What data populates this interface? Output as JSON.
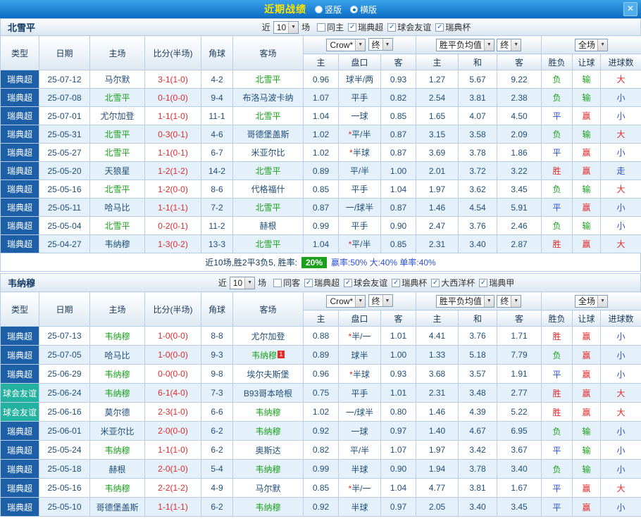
{
  "titlebar": {
    "title": "近期战绩",
    "options": [
      {
        "label": "竖版",
        "selected": false
      },
      {
        "label": "横版",
        "selected": true
      }
    ],
    "close_label": "✕"
  },
  "colors": {
    "win": "#e02b2b",
    "draw": "#2b50d9",
    "lose": "#1ca11c",
    "focus_team": "#1ca11c",
    "score": "#e02b2b",
    "league_super_bg": "#1d60a8",
    "league_friendly_bg": "#23b1a0",
    "title_text": "#ffe400",
    "rate_badge_bg": "#1ca11c"
  },
  "table_header": {
    "static_cols": [
      "类型",
      "日期",
      "主场",
      "比分(半场)",
      "角球",
      "客场"
    ],
    "groups": [
      {
        "selects": [
          "Crow*",
          "终"
        ],
        "subs": [
          "主",
          "盘口",
          "客"
        ]
      },
      {
        "selects": [
          "胜平负均值",
          "终"
        ],
        "subs": [
          "主",
          "和",
          "客"
        ]
      },
      {
        "selects": [
          "全场"
        ],
        "subs": [
          "胜负",
          "让球",
          "进球数"
        ]
      }
    ]
  },
  "sections": [
    {
      "team": "北雪平",
      "filter": {
        "near": "近",
        "count": "10",
        "games": "场",
        "checkboxes": [
          {
            "label": "同主",
            "checked": false
          },
          {
            "label": "瑞典超",
            "checked": true
          },
          {
            "label": "球会友谊",
            "checked": true
          },
          {
            "label": "瑞典杯",
            "checked": true
          }
        ]
      },
      "rows": [
        {
          "league": "瑞典超",
          "date": "25-07-12",
          "home": "马尔默",
          "score": "3-1(1-0)",
          "corners": "4-2",
          "away": "北雪平",
          "focus": "away",
          "crow": [
            "0.96",
            "球半/两",
            "0.93"
          ],
          "odds": [
            "1.27",
            "5.67",
            "9.22"
          ],
          "results": [
            "负",
            "输",
            "大"
          ]
        },
        {
          "league": "瑞典超",
          "date": "25-07-08",
          "home": "北雪平",
          "score": "0-1(0-0)",
          "corners": "9-4",
          "away": "布洛马波卡纳",
          "focus": "home",
          "crow": [
            "1.07",
            "平手",
            "0.82"
          ],
          "odds": [
            "2.54",
            "3.81",
            "2.38"
          ],
          "results": [
            "负",
            "输",
            "小"
          ]
        },
        {
          "league": "瑞典超",
          "date": "25-07-01",
          "home": "尤尔加登",
          "score": "1-1(1-0)",
          "corners": "11-1",
          "away": "北雪平",
          "focus": "away",
          "crow": [
            "1.04",
            "一球",
            "0.85"
          ],
          "odds": [
            "1.65",
            "4.07",
            "4.50"
          ],
          "results": [
            "平",
            "赢",
            "小"
          ]
        },
        {
          "league": "瑞典超",
          "date": "25-05-31",
          "home": "北雪平",
          "score": "0-3(0-1)",
          "corners": "4-6",
          "away": "哥德堡盖斯",
          "focus": "home",
          "crow": [
            "1.02",
            "*平/半",
            "0.87"
          ],
          "odds": [
            "3.15",
            "3.58",
            "2.09"
          ],
          "results": [
            "负",
            "输",
            "大"
          ]
        },
        {
          "league": "瑞典超",
          "date": "25-05-27",
          "home": "北雪平",
          "score": "1-1(0-1)",
          "corners": "6-7",
          "away": "米亚尔比",
          "focus": "home",
          "crow": [
            "1.02",
            "*半球",
            "0.87"
          ],
          "odds": [
            "3.69",
            "3.78",
            "1.86"
          ],
          "results": [
            "平",
            "赢",
            "小"
          ]
        },
        {
          "league": "瑞典超",
          "date": "25-05-20",
          "home": "天狼星",
          "score": "1-2(1-2)",
          "corners": "14-2",
          "away": "北雪平",
          "focus": "away",
          "crow": [
            "0.89",
            "平/半",
            "1.00"
          ],
          "odds": [
            "2.01",
            "3.72",
            "3.22"
          ],
          "results": [
            "胜",
            "赢",
            "走"
          ]
        },
        {
          "league": "瑞典超",
          "date": "25-05-16",
          "home": "北雪平",
          "score": "1-2(0-0)",
          "corners": "8-6",
          "away": "代格福什",
          "focus": "home",
          "crow": [
            "0.85",
            "平手",
            "1.04"
          ],
          "odds": [
            "1.97",
            "3.62",
            "3.45"
          ],
          "results": [
            "负",
            "输",
            "大"
          ]
        },
        {
          "league": "瑞典超",
          "date": "25-05-11",
          "home": "哈马比",
          "score": "1-1(1-1)",
          "corners": "7-2",
          "away": "北雪平",
          "focus": "away",
          "crow": [
            "0.87",
            "一/球半",
            "0.87"
          ],
          "odds": [
            "1.46",
            "4.54",
            "5.91"
          ],
          "results": [
            "平",
            "赢",
            "小"
          ]
        },
        {
          "league": "瑞典超",
          "date": "25-05-04",
          "home": "北雪平",
          "score": "0-2(0-1)",
          "corners": "11-2",
          "away": "赫根",
          "focus": "home",
          "crow": [
            "0.99",
            "平手",
            "0.90"
          ],
          "odds": [
            "2.47",
            "3.76",
            "2.46"
          ],
          "results": [
            "负",
            "输",
            "小"
          ]
        },
        {
          "league": "瑞典超",
          "date": "25-04-27",
          "home": "韦纳穆",
          "score": "1-3(0-2)",
          "corners": "13-3",
          "away": "北雪平",
          "focus": "away",
          "crow": [
            "1.04",
            "*平/半",
            "0.85"
          ],
          "odds": [
            "2.31",
            "3.40",
            "2.87"
          ],
          "results": [
            "胜",
            "赢",
            "大"
          ]
        }
      ],
      "summary": {
        "prefix": "近10场,胜2平3负5, 胜率:",
        "badge": "20%",
        "tail": "赢率:50% 大:40% 单率:40%"
      }
    },
    {
      "team": "韦纳穆",
      "filter": {
        "near": "近",
        "count": "10",
        "games": "场",
        "checkboxes": [
          {
            "label": "同客",
            "checked": false
          },
          {
            "label": "瑞典超",
            "checked": true
          },
          {
            "label": "球会友谊",
            "checked": true
          },
          {
            "label": "瑞典杯",
            "checked": true
          },
          {
            "label": "大西洋杯",
            "checked": true
          },
          {
            "label": "瑞典甲",
            "checked": true
          }
        ]
      },
      "rows": [
        {
          "league": "瑞典超",
          "date": "25-07-13",
          "home": "韦纳穆",
          "score": "1-0(0-0)",
          "corners": "8-8",
          "away": "尤尔加登",
          "focus": "home",
          "crow": [
            "0.88",
            "*半/一",
            "1.01"
          ],
          "odds": [
            "4.41",
            "3.76",
            "1.71"
          ],
          "results": [
            "胜",
            "赢",
            "小"
          ]
        },
        {
          "league": "瑞典超",
          "date": "25-07-05",
          "home": "哈马比",
          "score": "1-0(0-0)",
          "corners": "9-3",
          "away": "韦纳穆",
          "away_badge": "1",
          "focus": "away",
          "crow": [
            "0.89",
            "球半",
            "1.00"
          ],
          "odds": [
            "1.33",
            "5.18",
            "7.79"
          ],
          "results": [
            "负",
            "赢",
            "小"
          ]
        },
        {
          "league": "瑞典超",
          "date": "25-06-29",
          "home": "韦纳穆",
          "score": "0-0(0-0)",
          "corners": "9-8",
          "away": "埃尔夫斯堡",
          "focus": "home",
          "crow": [
            "0.96",
            "*半球",
            "0.93"
          ],
          "odds": [
            "3.68",
            "3.57",
            "1.91"
          ],
          "results": [
            "平",
            "赢",
            "小"
          ]
        },
        {
          "league": "球会友谊",
          "date": "25-06-24",
          "home": "韦纳穆",
          "score": "6-1(4-0)",
          "corners": "7-3",
          "away": "B93哥本哈根",
          "focus": "home",
          "crow": [
            "0.75",
            "平手",
            "1.01"
          ],
          "odds": [
            "2.31",
            "3.48",
            "2.77"
          ],
          "results": [
            "胜",
            "赢",
            "大"
          ]
        },
        {
          "league": "球会友谊",
          "date": "25-06-16",
          "home": "莫尔德",
          "score": "2-3(1-0)",
          "corners": "6-6",
          "away": "韦纳穆",
          "focus": "away",
          "crow": [
            "1.02",
            "一/球半",
            "0.80"
          ],
          "odds": [
            "1.46",
            "4.39",
            "5.22"
          ],
          "results": [
            "胜",
            "赢",
            "大"
          ]
        },
        {
          "league": "瑞典超",
          "date": "25-06-01",
          "home": "米亚尔比",
          "score": "2-0(0-0)",
          "corners": "6-2",
          "away": "韦纳穆",
          "focus": "away",
          "crow": [
            "0.92",
            "一球",
            "0.97"
          ],
          "odds": [
            "1.40",
            "4.67",
            "6.95"
          ],
          "results": [
            "负",
            "输",
            "小"
          ]
        },
        {
          "league": "瑞典超",
          "date": "25-05-24",
          "home": "韦纳穆",
          "score": "1-1(1-0)",
          "corners": "6-2",
          "away": "奥斯达",
          "focus": "home",
          "crow": [
            "0.82",
            "平/半",
            "1.07"
          ],
          "odds": [
            "1.97",
            "3.42",
            "3.67"
          ],
          "results": [
            "平",
            "输",
            "小"
          ]
        },
        {
          "league": "瑞典超",
          "date": "25-05-18",
          "home": "赫根",
          "score": "2-0(1-0)",
          "corners": "5-4",
          "away": "韦纳穆",
          "focus": "away",
          "crow": [
            "0.99",
            "半球",
            "0.90"
          ],
          "odds": [
            "1.94",
            "3.78",
            "3.40"
          ],
          "results": [
            "负",
            "输",
            "小"
          ]
        },
        {
          "league": "瑞典超",
          "date": "25-05-16",
          "home": "韦纳穆",
          "score": "2-2(1-2)",
          "corners": "4-9",
          "away": "马尔默",
          "focus": "home",
          "crow": [
            "0.85",
            "*半/一",
            "1.04"
          ],
          "odds": [
            "4.77",
            "3.81",
            "1.67"
          ],
          "results": [
            "平",
            "赢",
            "大"
          ]
        },
        {
          "league": "瑞典超",
          "date": "25-05-10",
          "home": "哥德堡盖斯",
          "score": "1-1(1-1)",
          "corners": "6-2",
          "away": "韦纳穆",
          "focus": "away",
          "crow": [
            "0.92",
            "半球",
            "0.97"
          ],
          "odds": [
            "2.05",
            "3.40",
            "3.45"
          ],
          "results": [
            "平",
            "赢",
            "小"
          ]
        }
      ]
    }
  ]
}
